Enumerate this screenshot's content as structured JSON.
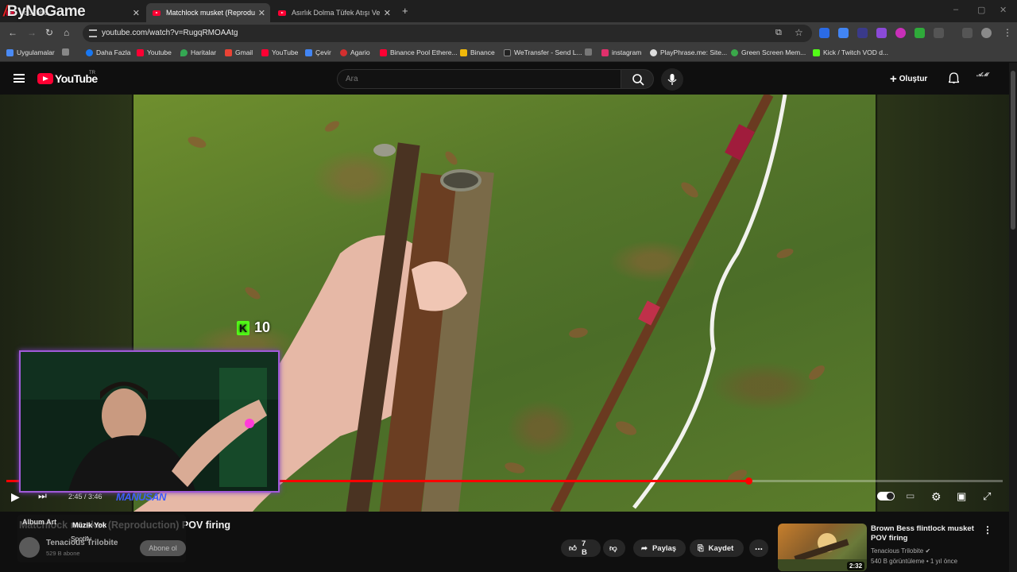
{
  "overlay": {
    "streamer_logo": "ByNoGame",
    "kick_count": "10",
    "streamer_name": "MANUSAN"
  },
  "browser": {
    "tabs": [
      {
        "label": "YouTube"
      },
      {
        "label": "Matchlock musket (Reproductio"
      },
      {
        "label": "Asırlık Dolma Tüfek Atışı Ve Pat"
      }
    ],
    "new_tab": "+",
    "url": "youtube.com/watch?v=RugqRMOAAtg",
    "bookmarks": [
      "Uygulamalar",
      "Daha Fazla",
      "Youtube",
      "Haritalar",
      "Gmail",
      "YouTube",
      "Çevir",
      "Agario",
      "Binance Pool Ethere...",
      "Binance",
      "WeTransfer - Send L...",
      "instagram",
      "PlayPhrase.me: Site...",
      "Green Screen Mem...",
      "Kick / Twitch VOD d..."
    ]
  },
  "youtube": {
    "logo_text": "YouTube",
    "region": "TR",
    "search_placeholder": "Ara",
    "create_label": "Oluştur",
    "player": {
      "time": "2:45 / 3:46",
      "progress_fraction": 0.745
    },
    "video": {
      "title": "Matchlock musket (Reproduction) POV firing",
      "channel": "Tenacious Trilobite",
      "subscribers": "529 B abone",
      "subscribe_label": "Abone ol",
      "likes": "7 B",
      "share_label": "Paylaş",
      "save_label": "Kaydet",
      "more_label": "..."
    },
    "music_overlay": {
      "album_art": "Album Art",
      "status": "Müzik Yok",
      "source": "Spotify"
    },
    "recommended": {
      "title": "Brown Bess flintlock musket POV firing",
      "channel": "Tenacious Trilobite",
      "meta": "540 B görüntüleme • 1 yıl önce",
      "duration": "2:32"
    }
  },
  "colors": {
    "accent": "#ff0033",
    "progress": "#ff0000",
    "kick": "#53fc18",
    "webcam_border": "#a05ad8"
  }
}
